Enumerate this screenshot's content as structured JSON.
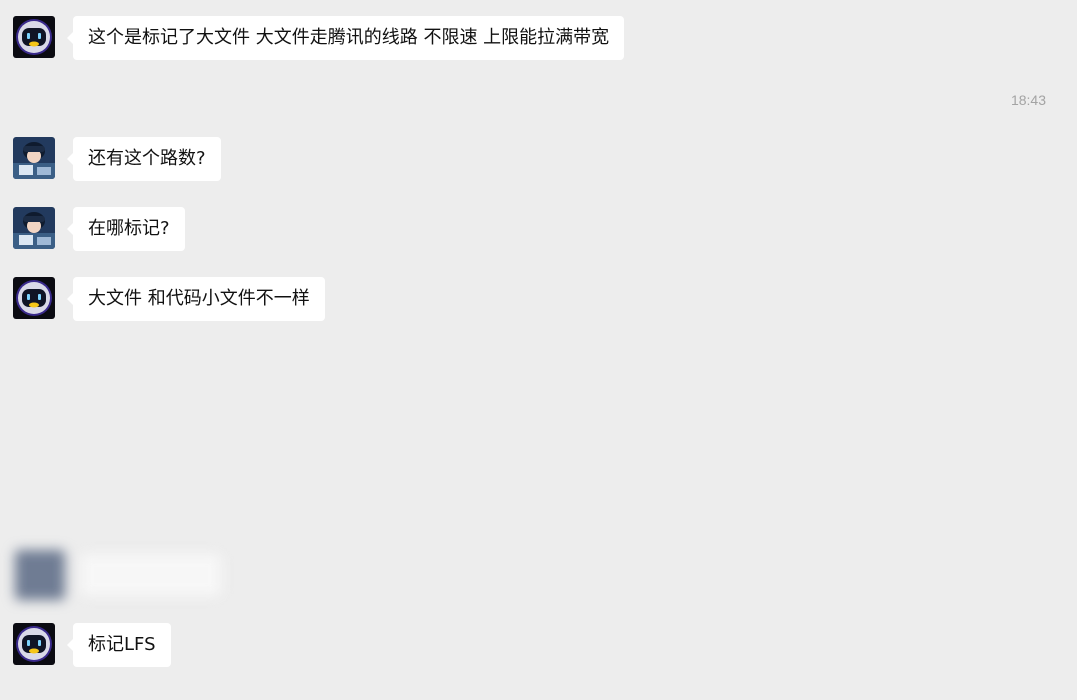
{
  "messages": [
    {
      "sender": "bot",
      "text": "这个是标记了大文件 大文件走腾讯的线路 不限速 上限能拉满带宽"
    },
    {
      "sender": "user",
      "text": "还有这个路数?"
    },
    {
      "sender": "user",
      "text": "在哪标记?"
    },
    {
      "sender": "bot",
      "text": "大文件 和代码小文件不一样"
    },
    {
      "sender": "bot",
      "text": "标记LFS"
    }
  ],
  "timestamp": "18:43",
  "colors": {
    "background": "#ededed",
    "bubble": "#ffffff",
    "timestamp": "#a3a3a3"
  },
  "icons": {
    "bot_avatar": "robot-avatar-icon",
    "user_avatar": "anime-user-avatar-icon",
    "cursor": "mouse-pointer-icon"
  }
}
